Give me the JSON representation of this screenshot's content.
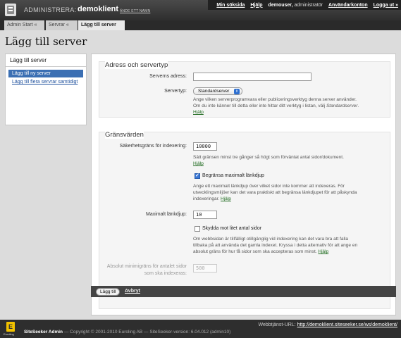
{
  "header": {
    "admin_label": "ADMINISTRERA:",
    "client_name": "demoklient",
    "change_name": "ÄNDE ETT NAMN",
    "nav": {
      "start": "Min söksida",
      "help": "Hjälp",
      "user": "demouser,",
      "role": "administratör",
      "accounts": "Användarkonton",
      "logout": "Logga ut »"
    }
  },
  "breadcrumbs": [
    "Admin Start  «",
    "Servrar  «",
    "Lägg till server"
  ],
  "page_title": "Lägg till server",
  "sidebar": {
    "title": "Lägg till server",
    "items": [
      {
        "label": "Lägg till ny server",
        "active": true
      },
      {
        "label": "Lägg till flera servrar samtidigt",
        "active": false
      }
    ]
  },
  "address_section": {
    "title": "Adress och servertyp",
    "server_address_label": "Serverns adress:",
    "server_address_value": "",
    "server_type_label": "Servertyp:",
    "server_type_value": "Standardserver",
    "help_text_1": "Ange vilken serverprogramvara eller publiceringsverktyg denna server använder. Om du inte känner till detta eller inte hittar ditt verktyg i listan, välj",
    "help_italic": "Standardserver",
    "help_link": "Hjälp"
  },
  "limits_section": {
    "title": "Gränsvärden",
    "index_limit_label": "Säkerhetsgräns för indexering:",
    "index_limit_value": "10000",
    "index_help": "Sätt gränsen minst tre gånger så högt som förväntat antal sidor/dokument.",
    "index_help_link": "Hjälp",
    "limit_link_label": "Begränsa maximalt länkdjup",
    "limit_link_checked": true,
    "limit_link_help": "Ange ett maximalt länkdjup över vilket sidor inte kommer att indexeras. För utvecklingsmiljöer kan det vara praktiskt att begränsa länkdjupet för att påskynda indexeringar.",
    "limit_link_help_link": "Hjälp",
    "max_depth_label": "Maximalt länkdjup:",
    "max_depth_value": "10",
    "protect_label": "Skydda mot litet antal sidor",
    "protect_checked": false,
    "protect_help": "Om webbsidan är tillfälligt otillgänglig vid indexering kan det vara bra att falla tillbaka på att använda det gamla indexet. Kryssa i detta alternativ för att ange en absolut gräns för hur få sidor som ska accepteras som minst.",
    "protect_help_link": "Hjälp",
    "min_pages_label_1": "Absolut minimigräns för antalet sidor",
    "min_pages_label_2": "som ska indexeras:",
    "min_pages_value": "500"
  },
  "buttons": {
    "add": "Lägg till",
    "cancel": "Avbryt"
  },
  "footer": {
    "logo_text": "Euroling",
    "url_label": "Webbtjänst-URL:",
    "url": "http://demoklient.siteseeker.se/ws/demoklient/",
    "product": "SiteSeeker Admin",
    "copyright": " — Copyright © 2001-2010 Euroling AB — SiteSeeker-version: 6.04.012 (admin10)"
  }
}
